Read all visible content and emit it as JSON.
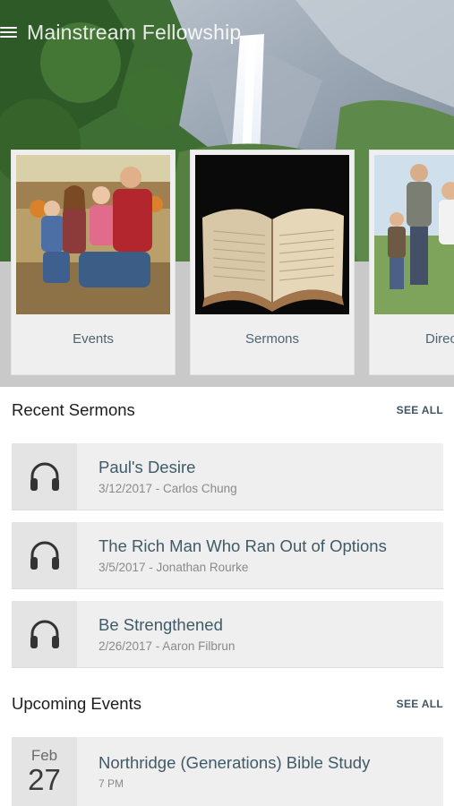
{
  "app": {
    "title": "Mainstream Fellowship"
  },
  "cards": [
    {
      "label": "Events"
    },
    {
      "label": "Sermons"
    },
    {
      "label": "Direc"
    }
  ],
  "recent_sermons": {
    "title": "Recent Sermons",
    "see_all": "SEE ALL",
    "items": [
      {
        "title": "Paul's Desire",
        "meta": "3/12/2017 - Carlos Chung",
        "icon": "headphones-icon"
      },
      {
        "title": "The Rich Man Who Ran Out of Options",
        "meta": "3/5/2017 - Jonathan Rourke",
        "icon": "headphones-icon"
      },
      {
        "title": "Be Strengthened",
        "meta": "2/26/2017 - Aaron Filbrun",
        "icon": "headphones-icon"
      }
    ]
  },
  "upcoming_events": {
    "title": "Upcoming Events",
    "see_all": "SEE ALL",
    "items": [
      {
        "month": "Feb",
        "day": "27",
        "title": "Northridge (Generations) Bible Study",
        "time": "7 PM"
      }
    ]
  },
  "colors": {
    "accent": "#405a66",
    "row_bg": "#efefef",
    "icon_bg": "#e4e4e4",
    "hero_lower": "#c9c9c9"
  }
}
